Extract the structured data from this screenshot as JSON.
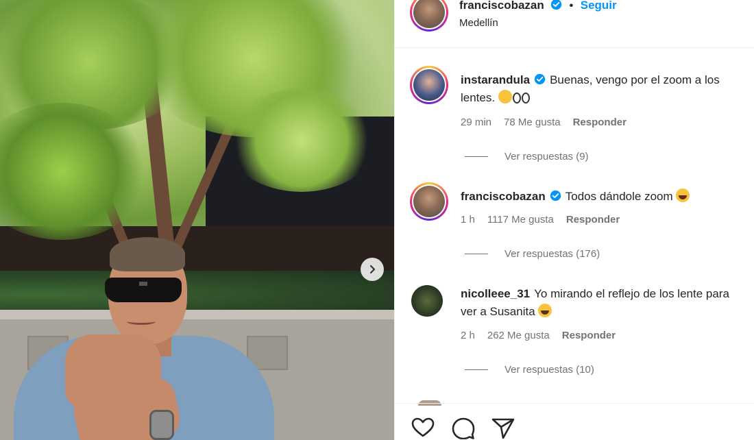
{
  "post": {
    "author": "franciscobazan",
    "separator": "•",
    "follow_label": "Seguir",
    "location": "Medellín"
  },
  "comments": [
    {
      "username": "instarandula",
      "verified": true,
      "text": "Buenas, vengo por el zoom a los lentes.",
      "time": "29 min",
      "likes": "78 Me gusta",
      "reply_label": "Responder",
      "view_replies": "Ver respuestas (9)"
    },
    {
      "username": "franciscobazan",
      "verified": true,
      "text": "Todos dándole zoom",
      "time": "1 h",
      "likes": "1117 Me gusta",
      "reply_label": "Responder",
      "view_replies": "Ver respuestas (176)"
    },
    {
      "username": "nicolleee_31",
      "verified": false,
      "text": "Yo mirando el reflejo de los lente para ver a Susanita",
      "time": "2 h",
      "likes": "262 Me gusta",
      "reply_label": "Responder",
      "view_replies": "Ver respuestas (10)"
    }
  ],
  "icons": {
    "verified": "verified-badge-icon",
    "next": "chevron-right-icon",
    "like": "heart-icon",
    "comment": "comment-icon",
    "share": "send-icon"
  },
  "colors": {
    "accent": "#0095f6",
    "text": "#262626",
    "muted": "#737373"
  }
}
